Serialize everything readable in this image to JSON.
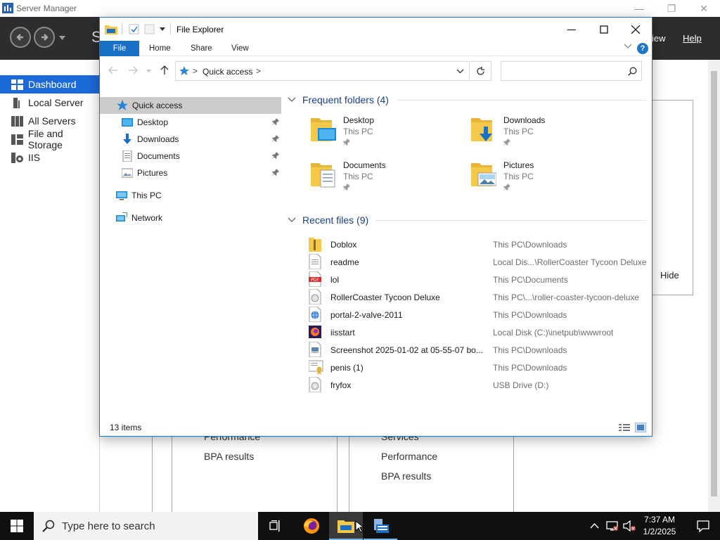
{
  "server_manager": {
    "title": "Server Manager",
    "header_partial_letter": "S",
    "menus": [
      {
        "label": "iew"
      },
      {
        "label": "Help"
      }
    ],
    "sidebar": [
      {
        "label": "Dashboard"
      },
      {
        "label": "Local Server"
      },
      {
        "label": "All Servers"
      },
      {
        "label": "File and Storage"
      },
      {
        "label": "IIS"
      }
    ],
    "tile_left": [
      "Performance",
      "BPA results"
    ],
    "tile_right": [
      "Services",
      "Performance",
      "BPA results"
    ],
    "hide_label": "Hide"
  },
  "file_explorer": {
    "title": "File Explorer",
    "ribbon_tabs": [
      {
        "label": "File"
      },
      {
        "label": "Home"
      },
      {
        "label": "Share"
      },
      {
        "label": "View"
      }
    ],
    "help_label": "?",
    "address": {
      "crumb": "Quick access",
      "separator": ">"
    },
    "search": {
      "placeholder": ""
    },
    "nav": {
      "quick_access": "Quick access",
      "pinned": [
        {
          "label": "Desktop"
        },
        {
          "label": "Downloads"
        },
        {
          "label": "Documents"
        },
        {
          "label": "Pictures"
        }
      ],
      "this_pc": "This PC",
      "network": "Network"
    },
    "frequent_header": "Frequent folders (4)",
    "frequent_folders": [
      {
        "name": "Desktop",
        "location": "This PC",
        "icon": "desktop-folder-icon"
      },
      {
        "name": "Downloads",
        "location": "This PC",
        "icon": "downloads-folder-icon"
      },
      {
        "name": "Documents",
        "location": "This PC",
        "icon": "documents-folder-icon"
      },
      {
        "name": "Pictures",
        "location": "This PC",
        "icon": "pictures-folder-icon"
      }
    ],
    "recent_header": "Recent files (9)",
    "recent_files": [
      {
        "name": "Doblox",
        "path": "This PC\\Downloads",
        "icon": "zip-folder-icon"
      },
      {
        "name": "readme",
        "path": "Local Dis...\\RollerCoaster Tycoon Deluxe",
        "icon": "text-file-icon"
      },
      {
        "name": "lol",
        "path": "This PC\\Documents",
        "icon": "pdf-file-icon"
      },
      {
        "name": "RollerCoaster Tycoon Deluxe",
        "path": "This PC\\...\\roller-coaster-tycoon-deluxe",
        "icon": "disc-image-icon"
      },
      {
        "name": "portal-2-valve-2011",
        "path": "This PC\\Downloads",
        "icon": "web-file-icon"
      },
      {
        "name": "iisstart",
        "path": "Local Disk (C:)\\inetpub\\wwwroot",
        "icon": "firefox-html-icon"
      },
      {
        "name": "Screenshot 2025-01-02 at 05-55-07 bo...",
        "path": "This PC\\Downloads",
        "icon": "image-file-icon"
      },
      {
        "name": "penis (1)",
        "path": "This PC\\Downloads",
        "icon": "certificate-file-icon"
      },
      {
        "name": "fryfox",
        "path": "USB Drive (D:)",
        "icon": "disc-image-icon"
      }
    ],
    "status": {
      "item_count": "13 items"
    }
  },
  "taskbar": {
    "search_placeholder": "Type here to search",
    "clock_time": "7:37 AM",
    "clock_date": "1/2/2025"
  },
  "colors": {
    "accent": "#1a6fc7",
    "sm_header": "#2d2d30",
    "sm_active": "#1c6ad8",
    "taskbar": "#101010",
    "folder_yellow": "#f4c849"
  }
}
